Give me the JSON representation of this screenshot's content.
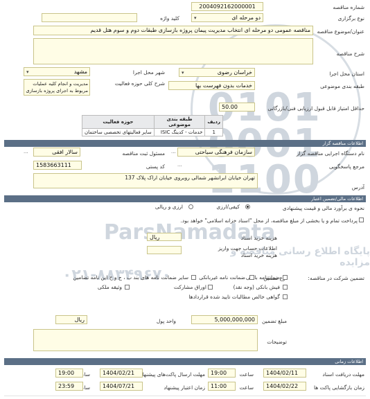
{
  "labels": {
    "tender_number": "شماره مناقصه",
    "procedure_type": "نوع برگزاری",
    "keyword": "کلید واژه",
    "subject": "عنوان/موضوع مناقصه",
    "description": "شرح مناقصه",
    "province": "استان محل اجرا",
    "city": "شهر محل اجرا",
    "category": "طبقه بندی موضوعی",
    "scope": "شرح کلی حوزه فعالیت",
    "min_score": "حداقل امتیاز قابل قبول ارزیابی فنی/بازرگانی",
    "organizer_name": "نام دستگاه اجرایی مناقصه گزار",
    "contact_person": "مسئول ثبت مناقصه",
    "reference": "مرجع پاسخگویی",
    "postal_code": "کد پستی",
    "address": "آدرس",
    "evaluation_method": "نحوه ی برآورد مالی و قیمت پیشنهادی",
    "payment_note": "پرداخت تمام و یا بخشی از مبلغ مناقصه، از محل \"اسناد خزانه اسلامی\" خواهد بود.",
    "doc_fee": "هزینه خرید اسناد",
    "account_info": "اطلاعات حساب جهت واریز هزینه خرید اسناد",
    "guarantee_type": "نوع تضمین",
    "participation_guarantee": "تضمین شرکت در مناقصه:",
    "amount": "مبلغ تضمین",
    "unit": "واحد پول",
    "notes": "توضیحات",
    "send_deadline": "مهلت ارسال پاکت‌های پیشنهاد",
    "validity": "زمان اعتبار پیشنهاد",
    "opening_time": "زمان بازگشایی پاکت ها",
    "doc_purchase_deadline": "مهلت دریافت اسناد",
    "time": "ساعت"
  },
  "sections": {
    "organizer_info": "اطلاعات مناقصه گزار",
    "financial_info": "اطلاعات مالی/تضمین اعتبار",
    "time_info": "اطلاعات زمانی"
  },
  "values": {
    "tender_number": "2004092162000001",
    "procedure_type": "دو مرحله ای",
    "subject": "مناقصه عمومی دو مرحله ای انتخاب مدیریت پیمان پروژه بازسازی طبقات دوم و سوم هتل قدیم",
    "province": "خراسان رضوی",
    "city": "مشهد",
    "category": "خدمات بدون فهرست بها",
    "scope_text": "مدیریت و انجام کلیه عملیات مربوط به اجرای پروژه بازسازی",
    "min_score": "50.00",
    "organizer_name": "سازمان فرهنگی سیاحتی",
    "contact_person": "سالار افقی",
    "postal_code": "1583663111",
    "address": "تهران خیابان ابرانشهر شمالی روبروی خیابان اراک پلاک 137",
    "amount": "5,000,000,000",
    "currency": "ریال",
    "doc_fee_currency": "ریال"
  },
  "activity_table": {
    "headers": [
      "ردیف",
      "طبقه بندی موضوعی",
      "حوزه فعالیت"
    ],
    "rows": [
      [
        "1",
        "خدمات - کدینگ ISIC",
        "سایر فعالیتهای تخصصی ساختمان"
      ]
    ]
  },
  "options": {
    "quality_cost": "کیفی/ارزی",
    "quality_only": "ارزی و ریالی",
    "bank_guarantee": "ضمانتنامه بانکی",
    "insurance_guarantee": "ضمانتنامه بیمه",
    "deposit": "فیش بانکی (وجه نقد)",
    "bond": "اوراق مشارکت",
    "property": "وثیقه ملکی",
    "other_guarantee": "ضمانت نامه غیربانکی",
    "securities": "سایر ضمانت نامه های بند ب ، ج و ح این نامه تضامین",
    "receivables": "گواهی خالص مطالبات تایید شده قراردادها"
  },
  "times": {
    "send_deadline_date": "1404/02/21",
    "send_deadline_time": "19:00",
    "doc_deadline_date": "1404/02/11",
    "doc_deadline_time": "19:00",
    "opening_date": "1404/02/22",
    "opening_time": "11:00",
    "validity_date": "1404/07/21",
    "validity_time": "23:59"
  },
  "watermark": {
    "brand": "ParsNamadata",
    "sub": "پایگاه اطلاع رسانی مناقصه و مزایده",
    "phone": "۰۲۱-۸۸۳۴۹۶۷۰"
  },
  "icons": [
    "chevron-down-icon",
    "radio-icon",
    "checkbox-icon",
    "stamp-logo"
  ],
  "colors": {
    "field_bg": "#fffde6",
    "section_bar": "#5b6f86",
    "border": "#c9c48a"
  }
}
